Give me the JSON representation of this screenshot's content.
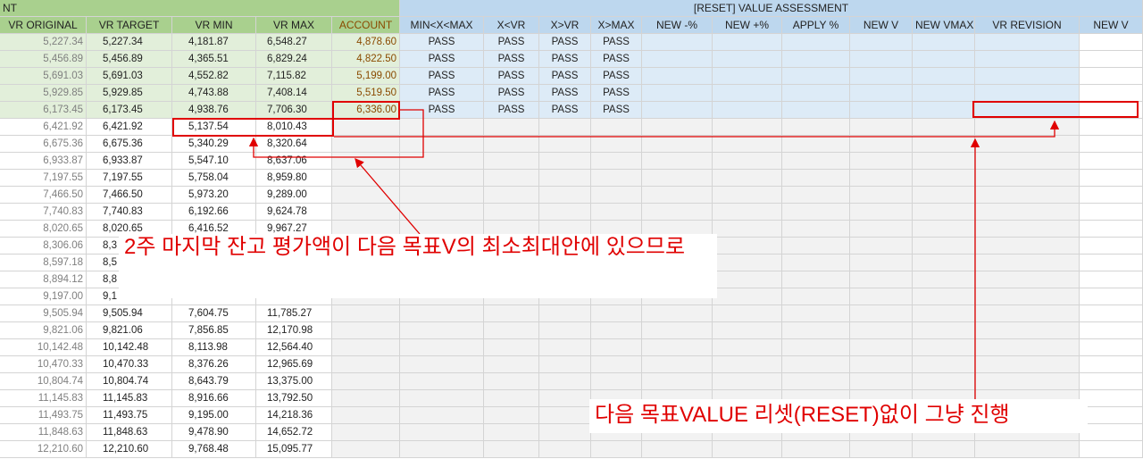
{
  "sheet": {
    "group_left": "NT",
    "group_right": "[RESET] VALUE ASSESSMENT",
    "columns": [
      "VR ORIGINAL",
      "VR TARGET",
      "VR MIN",
      "VR MAX",
      "ACCOUNT",
      "MIN<X<MAX",
      "X<VR",
      "X>VR",
      "X>MAX",
      "NEW -%",
      "NEW +%",
      "APPLY %",
      "NEW V",
      "NEW VMAX",
      "VR REVISION",
      "NEW V"
    ],
    "rows": [
      [
        "5,227.34",
        "5,227.34",
        "4,181.87",
        "6,548.27",
        "4,878.60",
        "PASS",
        "PASS",
        "PASS",
        "PASS"
      ],
      [
        "5,456.89",
        "5,456.89",
        "4,365.51",
        "6,829.24",
        "4,822.50",
        "PASS",
        "PASS",
        "PASS",
        "PASS"
      ],
      [
        "5,691.03",
        "5,691.03",
        "4,552.82",
        "7,115.82",
        "5,199.00",
        "PASS",
        "PASS",
        "PASS",
        "PASS"
      ],
      [
        "5,929.85",
        "5,929.85",
        "4,743.88",
        "7,408.14",
        "5,519.50",
        "PASS",
        "PASS",
        "PASS",
        "PASS"
      ],
      [
        "6,173.45",
        "6,173.45",
        "4,938.76",
        "7,706.30",
        "6,336.00",
        "PASS",
        "PASS",
        "PASS",
        "PASS"
      ],
      [
        "6,421.92",
        "6,421.92",
        "5,137.54",
        "8,010.43"
      ],
      [
        "6,675.36",
        "6,675.36",
        "5,340.29",
        "8,320.64"
      ],
      [
        "6,933.87",
        "6,933.87",
        "5,547.10",
        "8,637.06"
      ],
      [
        "7,197.55",
        "7,197.55",
        "5,758.04",
        "8,959.80"
      ],
      [
        "7,466.50",
        "7,466.50",
        "5,973.20",
        "9,289.00"
      ],
      [
        "7,740.83",
        "7,740.83",
        "6,192.66",
        "9,624.78"
      ],
      [
        "8,020.65",
        "8,020.65",
        "6,416.52",
        "9,967.27"
      ],
      [
        "8,306.06",
        "8,3",
        "",
        ""
      ],
      [
        "8,597.18",
        "8,5",
        "",
        ""
      ],
      [
        "8,894.12",
        "8,8",
        "",
        ""
      ],
      [
        "9,197.00",
        "9,1",
        "",
        ""
      ],
      [
        "9,505.94",
        "9,505.94",
        "7,604.75",
        "11,785.27"
      ],
      [
        "9,821.06",
        "9,821.06",
        "7,856.85",
        "12,170.98"
      ],
      [
        "10,142.48",
        "10,142.48",
        "8,113.98",
        "12,564.40"
      ],
      [
        "10,470.33",
        "10,470.33",
        "8,376.26",
        "12,965.69"
      ],
      [
        "10,804.74",
        "10,804.74",
        "8,643.79",
        "13,375.00"
      ],
      [
        "11,145.83",
        "11,145.83",
        "8,916.66",
        "13,792.50"
      ],
      [
        "11,493.75",
        "11,493.75",
        "9,195.00",
        "14,218.36"
      ],
      [
        "11,848.63",
        "11,848.63",
        "9,478.90",
        "14,652.72"
      ],
      [
        "12,210.60",
        "12,210.60",
        "9,768.48",
        "15,095.77"
      ]
    ]
  },
  "annotations": {
    "callout1": "2주 마지막 잔고 평가액이 다음 목표V의 최소최대안에 있으므로",
    "callout2": "다음 목표VALUE 리셋(RESET)없이 그냥 진행"
  },
  "colors": {
    "header_green": "#a9d08e",
    "header_blue": "#bdd7ee",
    "row_green": "#e2efda",
    "row_blue": "#ddebf7",
    "empty_grey": "#f2f2f2",
    "annotation_red": "#e00000",
    "account_text": "#8a4a00"
  }
}
